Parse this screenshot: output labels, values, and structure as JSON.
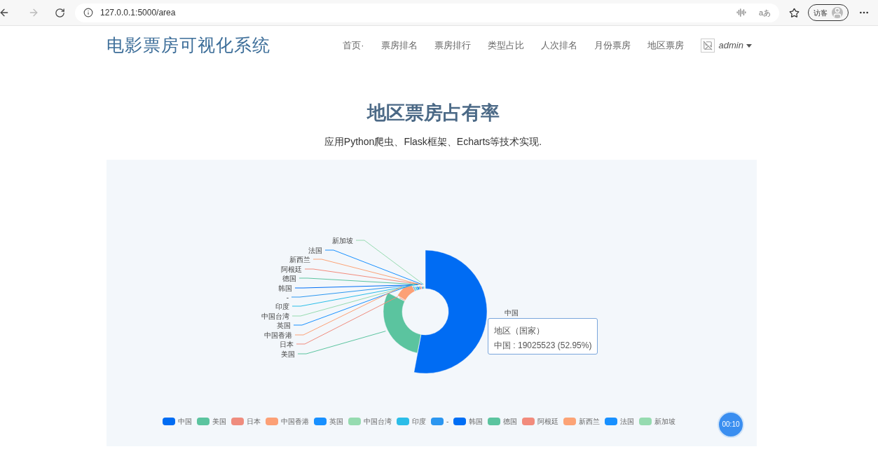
{
  "browser": {
    "url": "127.0.0.1:5000/area",
    "translate_label": "aあ",
    "profile_label": "访客"
  },
  "navbar": {
    "brand": "电影票房可视化系统",
    "items": [
      {
        "label": "首页·"
      },
      {
        "label": "票房排名"
      },
      {
        "label": "票房排行"
      },
      {
        "label": "类型占比"
      },
      {
        "label": "人次排名"
      },
      {
        "label": "月份票房"
      },
      {
        "label": "地区票房"
      }
    ],
    "user": "admin"
  },
  "heading": "地区票房占有率",
  "subtitle": "应用Python爬虫、Flask框架、Echarts等技术实现.",
  "chart": {
    "legend": [
      {
        "label": "中国",
        "color": "#006cf3"
      },
      {
        "label": "美国",
        "color": "#5bc49f"
      },
      {
        "label": "日本",
        "color": "#ef8c7e"
      },
      {
        "label": "中国香港",
        "color": "#fca076"
      },
      {
        "label": "英国",
        "color": "#1890ff"
      },
      {
        "label": "中国台湾",
        "color": "#96dbb0"
      },
      {
        "label": "印度",
        "color": "#2bbde8"
      },
      {
        "label": "-",
        "color": "#2b96f0"
      },
      {
        "label": "韩国",
        "color": "#006ef5"
      },
      {
        "label": "德国",
        "color": "#5bc49f"
      },
      {
        "label": "阿根廷",
        "color": "#f28b7c"
      },
      {
        "label": "新西兰",
        "color": "#fca376"
      },
      {
        "label": "法国",
        "color": "#1890ff"
      },
      {
        "label": "新加坡",
        "color": "#96dbb0"
      }
    ],
    "slice_labels": [
      "新加坡",
      "法国",
      "新西兰",
      "阿根廷",
      "德国",
      "韩国",
      "-",
      "印度",
      "中国台湾",
      "英国",
      "中国香港",
      "日本",
      "美国"
    ],
    "main_label": "中国",
    "tooltip": {
      "title": "地区（国家）",
      "text": "中国 : 19025523 (52.95%)"
    }
  },
  "timer": "00:10"
}
